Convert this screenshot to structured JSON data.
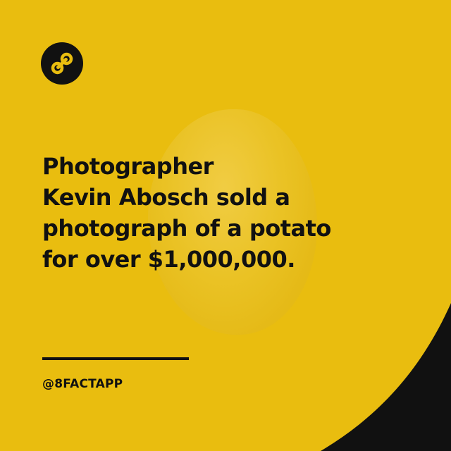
{
  "colors": {
    "background": "#e9bd0f",
    "text": "#111111",
    "corner": "#111111"
  },
  "logo": {
    "icon": "figure-eight-icon"
  },
  "headline": {
    "lines": [
      "Photographer",
      "Kevin Abosch sold a",
      "photograph of a potato",
      "for over $1,000,000."
    ]
  },
  "footer": {
    "handle": "@8FACTAPP"
  }
}
